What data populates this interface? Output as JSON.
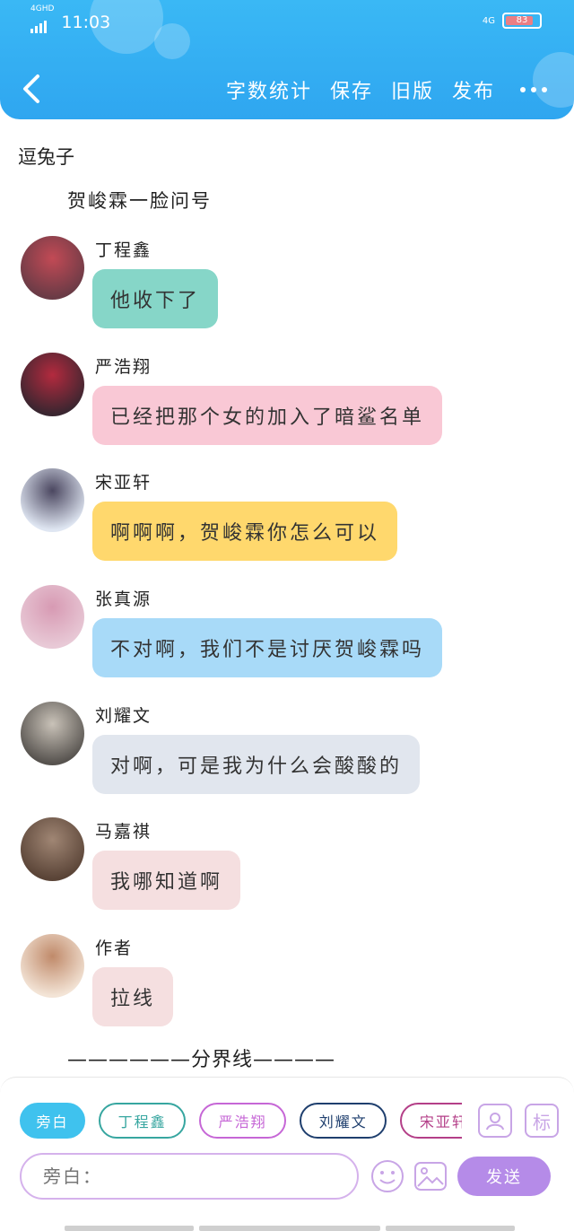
{
  "status_bar": {
    "network": "4G",
    "network_sub": "HD",
    "time": "11:03",
    "right_network": "4G",
    "battery": "83"
  },
  "nav": {
    "actions": [
      "字数统计",
      "保存",
      "旧版",
      "发布"
    ]
  },
  "story": {
    "title": "逗兔子",
    "narration": "贺峻霖一脸问号",
    "divider": "——————分界线————"
  },
  "messages": [
    {
      "name": "丁程鑫",
      "text": "他收下了",
      "bubble_color": "#86d6c8",
      "avatar_colors": [
        "#6a3b46",
        "#c24a55"
      ]
    },
    {
      "name": "严浩翔",
      "text": "已经把那个女的加入了暗鲨名单",
      "bubble_color": "#f9c8d5",
      "avatar_colors": [
        "#3a2630",
        "#b32a3e"
      ]
    },
    {
      "name": "宋亚轩",
      "text": "啊啊啊，贺峻霖你怎么可以",
      "bubble_color": "#ffd86d",
      "avatar_colors": [
        "#dfe6f2",
        "#4b4760"
      ]
    },
    {
      "name": "张真源",
      "text": "不对啊，我们不是讨厌贺峻霖吗",
      "bubble_color": "#a8daf8",
      "avatar_colors": [
        "#e8c9d6",
        "#d79ab3"
      ]
    },
    {
      "name": "刘耀文",
      "text": "对啊，可是我为什么会酸酸的",
      "bubble_color": "#e1e6ee",
      "avatar_colors": [
        "#57534f",
        "#c9c2b8"
      ]
    },
    {
      "name": "马嘉祺",
      "text": "我哪知道啊",
      "bubble_color": "#f5dfe0",
      "avatar_colors": [
        "#5a4437",
        "#a08674"
      ]
    },
    {
      "name": "作者",
      "text": "拉线",
      "bubble_color": "#f5dfe0",
      "avatar_colors": [
        "#f3e4d6",
        "#c08a6a"
      ]
    }
  ],
  "toolbar": {
    "chips": [
      "旁白",
      "丁程鑫",
      "严浩翔",
      "刘耀文",
      "宋亚轩"
    ],
    "role_icon": "user-card-icon",
    "mark_label": "标",
    "input_placeholder": "旁白：",
    "send_label": "发送"
  }
}
